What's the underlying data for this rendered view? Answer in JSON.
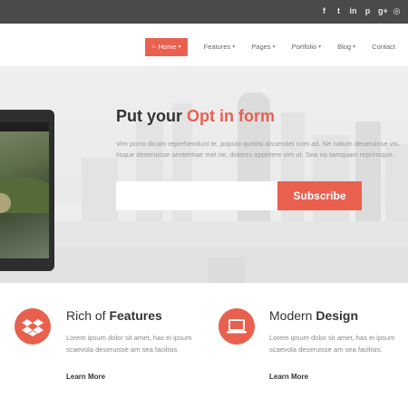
{
  "topbar": {
    "social_icons": [
      {
        "name": "facebook-icon",
        "glyph": "f"
      },
      {
        "name": "twitter-icon",
        "glyph": "t"
      },
      {
        "name": "linkedin-icon",
        "glyph": "in"
      },
      {
        "name": "pinterest-icon",
        "glyph": "p"
      },
      {
        "name": "google-plus-icon",
        "glyph": "g+"
      },
      {
        "name": "dribbble-icon",
        "glyph": "◎"
      }
    ]
  },
  "nav": {
    "items": [
      {
        "label": "Home",
        "active": true
      },
      {
        "label": "Features",
        "active": false
      },
      {
        "label": "Pages",
        "active": false
      },
      {
        "label": "Portfolio",
        "active": false
      },
      {
        "label": "Blog",
        "active": false
      },
      {
        "label": "Contact",
        "active": false
      }
    ]
  },
  "hero": {
    "title_prefix": "Put your ",
    "title_accent": "Opt in form",
    "text": "Vim porro dicam reprehendunt te, populo quodsi dissentiet cum ad. Ne natum deseruisse vis. Iisque deseruisse sententiae mel ne, dolores appetere vim ut. Sea no tamquam reprimique.",
    "input_value": "",
    "subscribe_label": "Subscribe"
  },
  "features": [
    {
      "icon": "dropbox-icon",
      "title_light": "Rich of ",
      "title_bold": "Features",
      "text": "Lorem ipsum dolor sit amet, has ei ipsum scaevola deseruisse am sea facilisis.",
      "link": "Learn More"
    },
    {
      "icon": "laptop-icon",
      "title_light": "Modern ",
      "title_bold": "Design",
      "text": "Lorem ipsum dolor sit amet, has ei ipsum scaevola deseruisse am sea facilisis.",
      "link": "Learn More"
    }
  ],
  "colors": {
    "accent": "#e9604f",
    "topbar": "#4a4a4a"
  }
}
